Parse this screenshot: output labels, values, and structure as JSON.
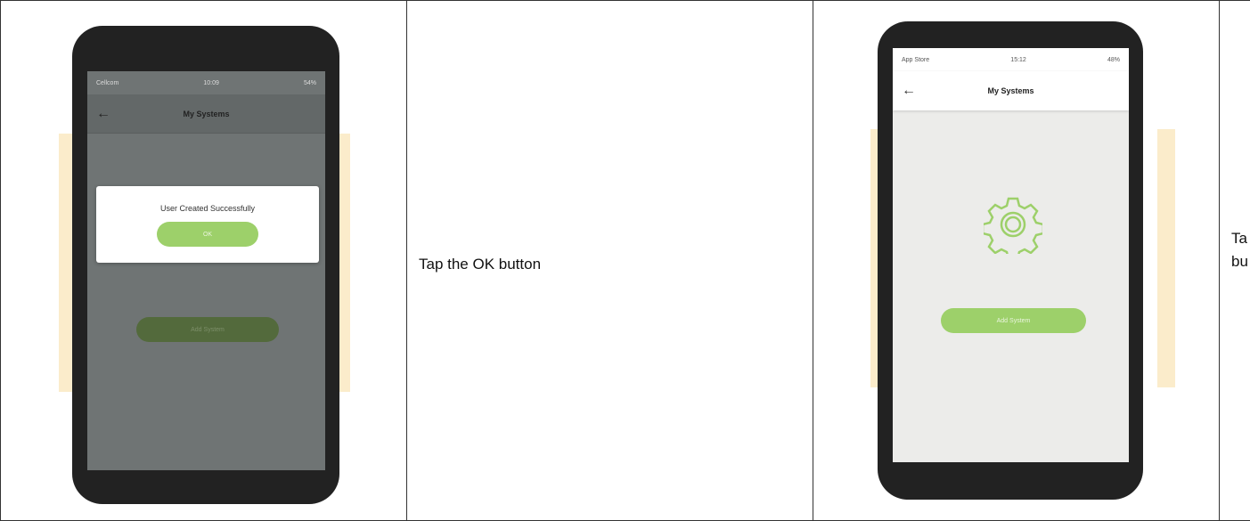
{
  "left_phone": {
    "status": {
      "carrier": "Cellcom",
      "time": "10:09",
      "battery": "54%"
    },
    "title": "My Systems",
    "dialog_message": "User Created Successfully",
    "ok_label": "OK",
    "add_system_label": "Add System"
  },
  "middle_text": "Tap the OK button",
  "right_phone": {
    "status": {
      "carrier": "App Store",
      "time": "15:12",
      "battery": "48%"
    },
    "title": "My Systems",
    "add_system_label": "Add System"
  },
  "right_text_line1": "Ta",
  "right_text_line2": "bu",
  "colors": {
    "overlay_screen": "#6f7474",
    "light_screen": "#ececea",
    "green": "#9dd06a",
    "dark_green": "#536a3c",
    "phone_frame": "#222222"
  },
  "icons": [
    "back-arrow-icon",
    "gear-icon",
    "wifi-icon",
    "battery-icon"
  ]
}
